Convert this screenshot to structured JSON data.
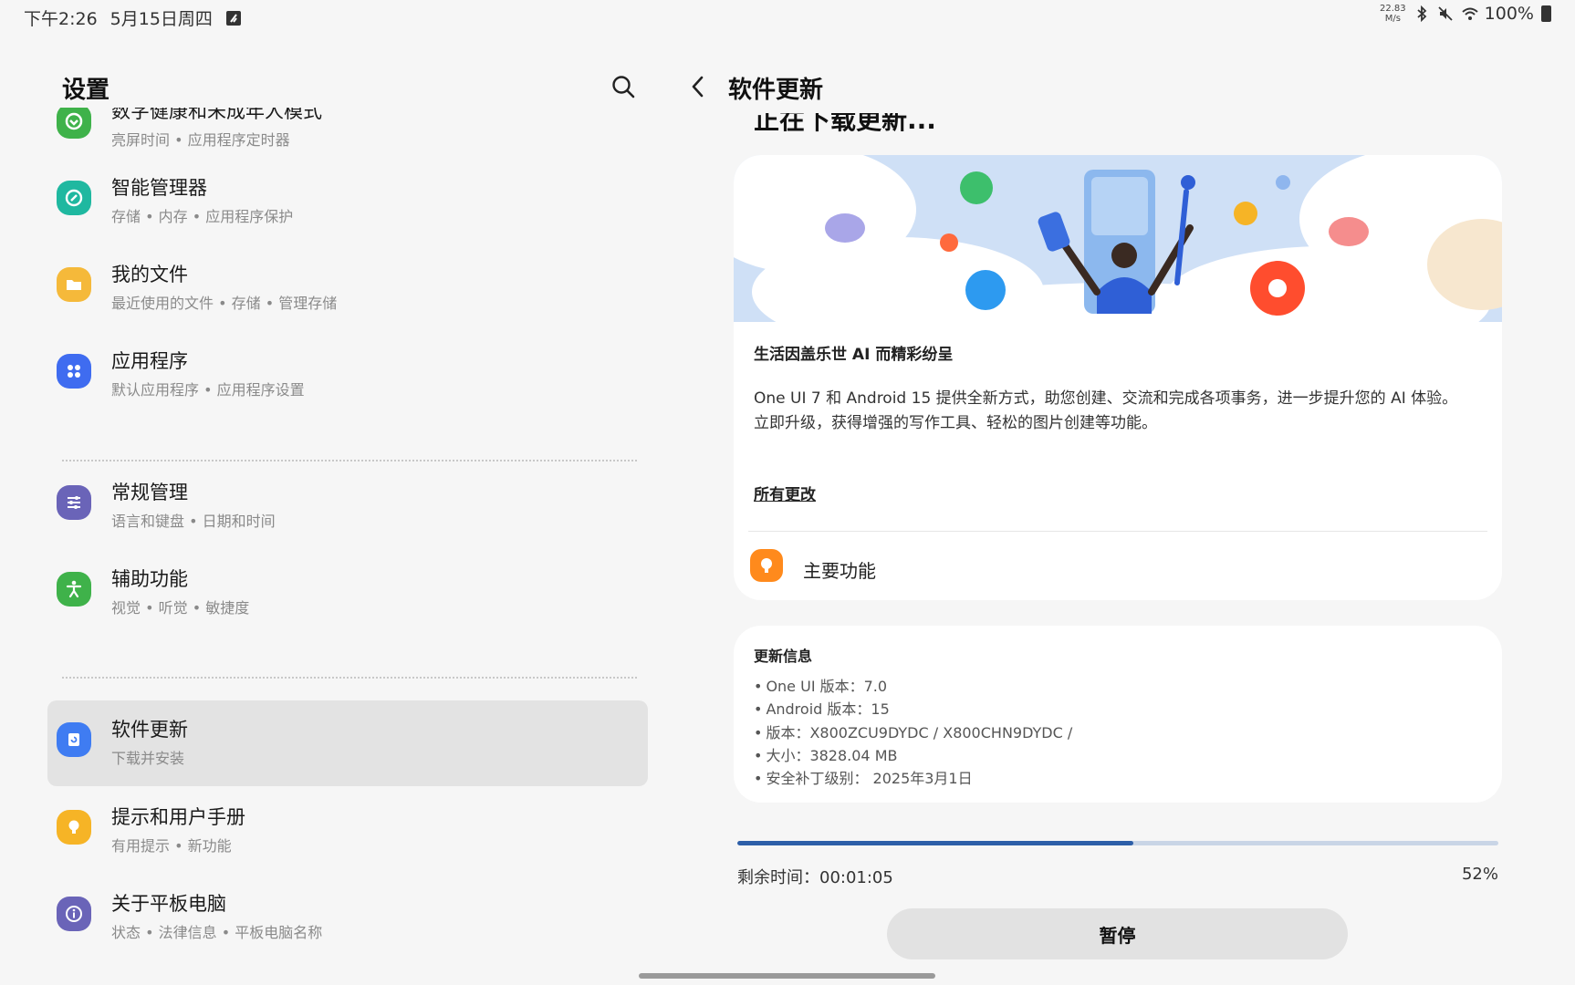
{
  "status_bar": {
    "time": "下午2:26",
    "date": "5月15日周四",
    "net_speed_value": "22.83",
    "net_speed_unit": "M/s",
    "battery": "100%",
    "icons": [
      "nfc-icon",
      "bluetooth-icon",
      "mute-icon",
      "wifi-icon",
      "battery-icon"
    ]
  },
  "left_pane": {
    "title": "设置",
    "partial_item": {
      "label": "数字健康和未成年人模式",
      "subtitle": "亮屏时间 • 应用程序定时器"
    },
    "items": [
      {
        "label": "智能管理器",
        "subtitle": "存储 • 内存 • 应用程序保护",
        "icon": "device-care-icon",
        "color": "#1fb8a0"
      },
      {
        "label": "我的文件",
        "subtitle": "最近使用的文件 • 存储 • 管理存储",
        "icon": "folder-icon",
        "color": "#f5b93a"
      },
      {
        "label": "应用程序",
        "subtitle": "默认应用程序 • 应用程序设置",
        "icon": "apps-icon",
        "color": "#3f6cf0"
      },
      {
        "label": "常规管理",
        "subtitle": "语言和键盘 • 日期和时间",
        "icon": "sliders-icon",
        "color": "#6a64b8"
      },
      {
        "label": "辅助功能",
        "subtitle": "视觉 • 听觉 • 敏捷度",
        "icon": "accessibility-icon",
        "color": "#3fb24a"
      },
      {
        "label": "软件更新",
        "subtitle": "下载并安装",
        "icon": "software-update-icon",
        "color": "#3f7cf2"
      },
      {
        "label": "提示和用户手册",
        "subtitle": "有用提示 • 新功能",
        "icon": "lightbulb-icon",
        "color": "#f6b426"
      },
      {
        "label": "关于平板电脑",
        "subtitle": "状态 • 法律信息 • 平板电脑名称",
        "icon": "info-icon",
        "color": "#6a64b8"
      }
    ]
  },
  "right_pane": {
    "title": "软件更新",
    "status_heading": "正在下载更新...",
    "headline": "生活因盖乐世 AI 而精彩纷呈",
    "description_line1": "One UI 7 和 Android 15 提供全新方式，助您创建、交流和完成各项事务，进一步提升您的 AI 体验。",
    "description_line2": "立即升级，获得增强的写作工具、轻松的图片创建等功能。",
    "all_changes": "所有更改",
    "main_features": "主要功能",
    "info_title": "更新信息",
    "info_items": [
      "One UI 版本：7.0",
      "Android 版本：15",
      "版本：X800ZCU9DYDC / X800CHN9DYDC /",
      "大小：3828.04 MB",
      "安全补丁级别：  2025年3月1日"
    ],
    "progress_fraction": 0.52,
    "remaining_time": "剩余时间：00:01:05",
    "percent": "52%",
    "pause_label": "暂停"
  }
}
